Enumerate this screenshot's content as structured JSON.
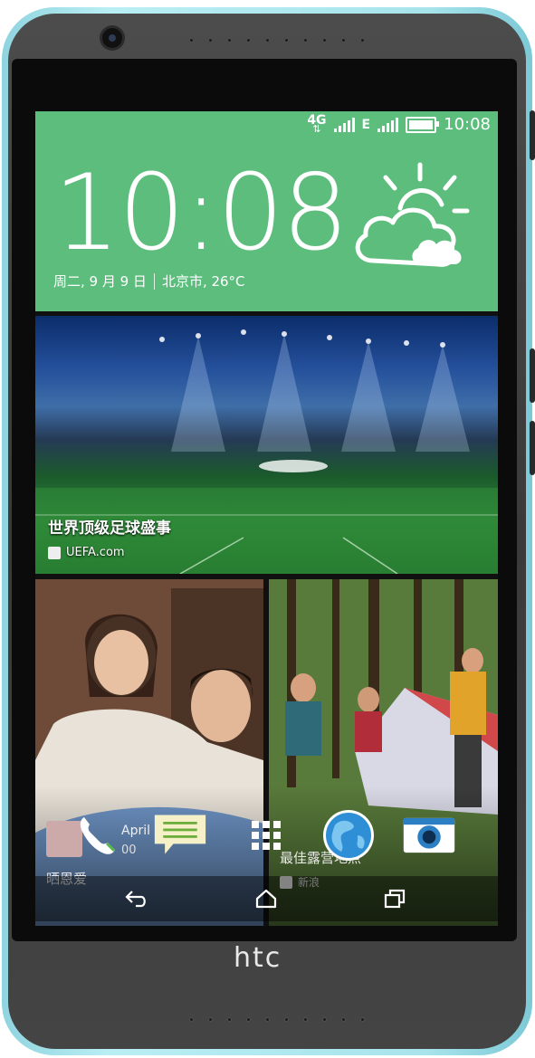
{
  "device": {
    "brand": "htc"
  },
  "status_bar": {
    "network_type": "4G",
    "network_secondary": "E",
    "time": "10:08"
  },
  "clock_widget": {
    "time": "10:08",
    "date": "周二, 9 月 9 日",
    "location_temp": "北京市, 26°C",
    "weather_icon": "partly-cloudy-icon",
    "panel_color": "#5cbd7d"
  },
  "news_card": {
    "title": "世界顶级足球盛事",
    "source": "UEFA.com"
  },
  "tile_left": {
    "peek_title": "April l",
    "peek_sub": "00",
    "caption": "晒恩爱"
  },
  "tile_right": {
    "caption": "最佳露营地点",
    "source": "新浪"
  },
  "dock": [
    "phone-icon",
    "messages-icon",
    "app-drawer-icon",
    "browser-icon",
    "camera-icon"
  ],
  "navigation": [
    "back-icon",
    "home-icon",
    "recent-apps-icon"
  ]
}
